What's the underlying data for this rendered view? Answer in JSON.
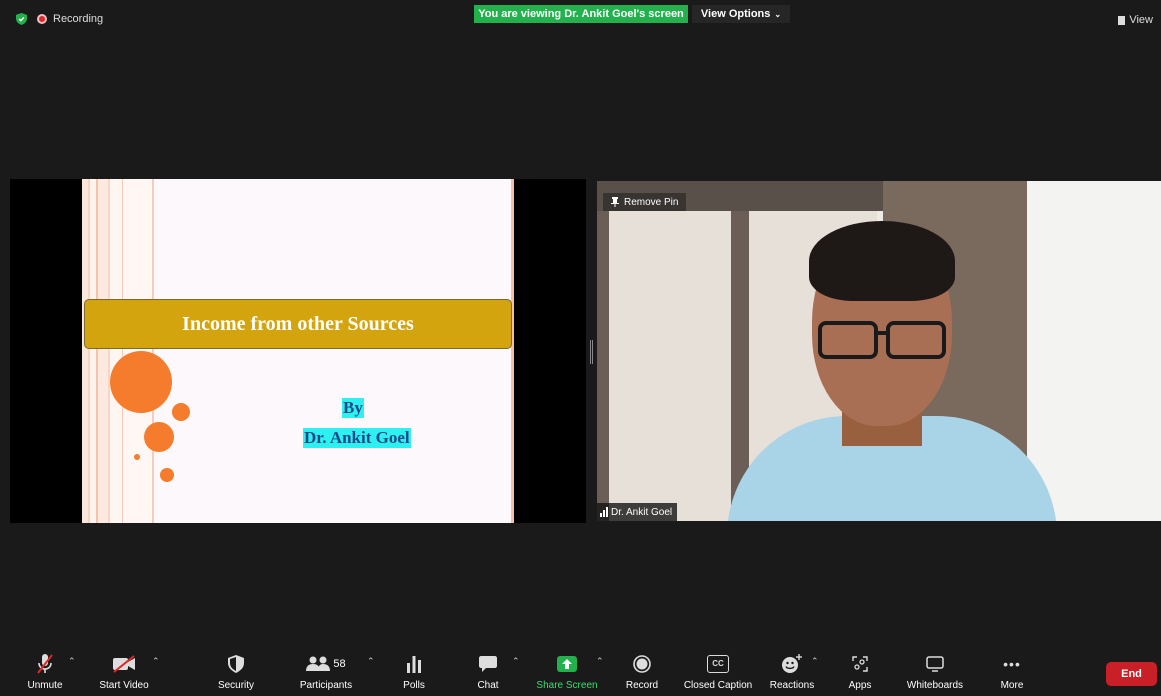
{
  "top_bar": {
    "recording_label": "Recording",
    "viewing_banner": "You are viewing Dr. Ankit Goel's screen",
    "view_options_label": "View Options",
    "view_label": "View"
  },
  "shared_screen": {
    "slide_title": "Income from other Sources",
    "by_label": "By",
    "author": "Dr. Ankit Goel"
  },
  "video_tile": {
    "remove_pin_label": "Remove Pin",
    "participant_name": "Dr. Ankit Goel"
  },
  "toolbar": {
    "unmute": "Unmute",
    "start_video": "Start Video",
    "security": "Security",
    "participants": "Participants",
    "participants_count": "58",
    "polls": "Polls",
    "chat": "Chat",
    "share_screen": "Share Screen",
    "record": "Record",
    "closed_caption": "Closed Caption",
    "closed_caption_icon_text": "CC",
    "reactions": "Reactions",
    "apps": "Apps",
    "whiteboards": "Whiteboards",
    "more": "More",
    "end": "End"
  },
  "colors": {
    "share_green": "#23b14d",
    "end_red": "#c91f27",
    "slide_gold": "#d4a40f",
    "slide_orange": "#f47c2c",
    "highlight_cyan": "#2ef0f0"
  },
  "icons": [
    "shield-icon",
    "recording-icon",
    "chevron-down-icon",
    "view-icon",
    "pin-icon",
    "signal-icon",
    "mic-muted-icon",
    "video-off-icon",
    "security-shield-icon",
    "participants-icon",
    "polls-icon",
    "chat-icon",
    "share-screen-icon",
    "record-icon",
    "closed-caption-icon",
    "reactions-icon",
    "apps-icon",
    "whiteboard-icon",
    "more-icon"
  ]
}
